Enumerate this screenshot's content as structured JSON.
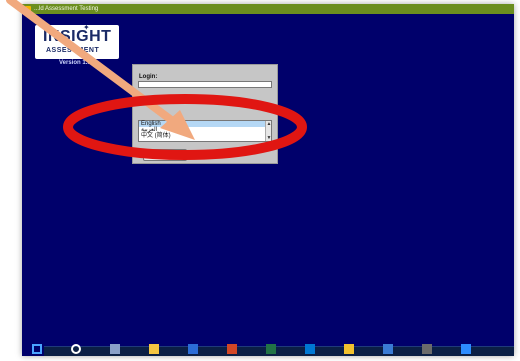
{
  "window": {
    "title": "...ld Assessment Testing"
  },
  "logo": {
    "main": "INSIGHT",
    "sub": "ASSESSMENT",
    "version": "Version 1..."
  },
  "login": {
    "label": "Login:",
    "value": "",
    "button": "Login"
  },
  "language_list": [
    "English",
    "العربية",
    "中文 (简体)"
  ],
  "colors": {
    "background": "#00006b",
    "titlebar": "#6b8e1f",
    "panel": "#c6c6c6",
    "annotation_arrow": "#f1a97e",
    "annotation_ellipse": "#e01612"
  },
  "taskbar": {
    "icons": [
      "windows-start-icon",
      "search-icon",
      "task-view-icon",
      "folder-icon",
      "word-icon",
      "powerpoint-icon",
      "excel-icon",
      "outlook-icon",
      "chrome-icon",
      "store-icon",
      "settings-icon",
      "mail-icon"
    ]
  }
}
